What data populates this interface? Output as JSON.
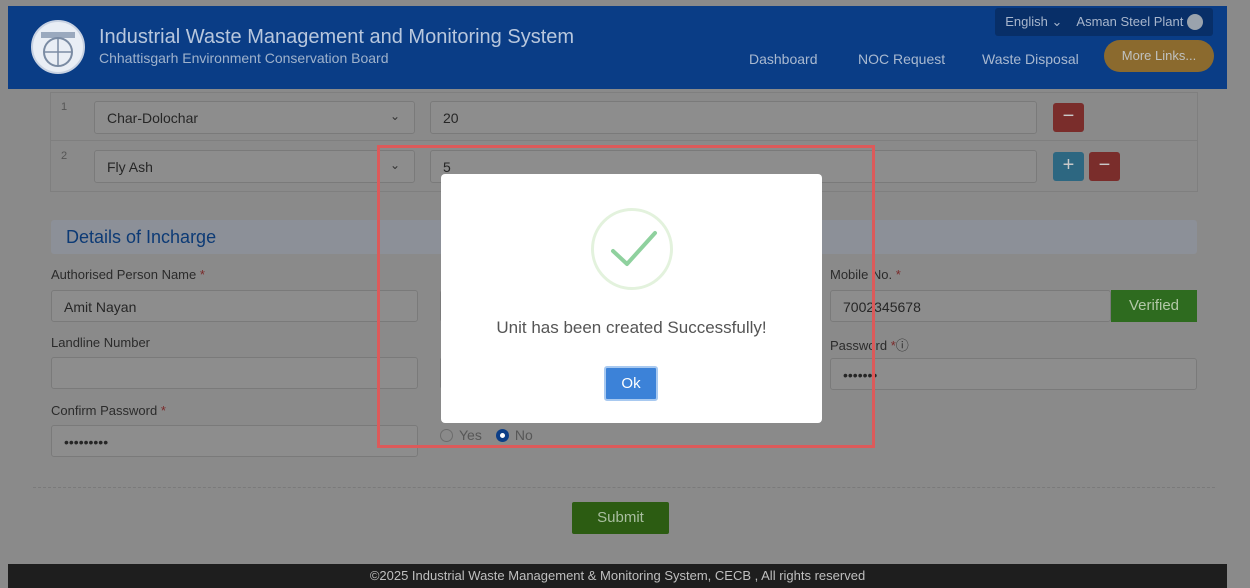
{
  "header": {
    "title": "Industrial Waste Management and Monitoring System",
    "subtitle": "Chhattisgarh Environment Conservation Board",
    "language": "English",
    "company": "Asman Steel Plant",
    "nav": [
      "Dashboard",
      "NOC Request",
      "Waste Disposal",
      "More Links..."
    ]
  },
  "waste_rows": [
    {
      "num": "1",
      "type": "Char-Dolochar",
      "qty": "20"
    },
    {
      "num": "2",
      "type": "Fly Ash",
      "qty": "5"
    }
  ],
  "incharge": {
    "section_title": "Details of Incharge",
    "auth_label": "Authorised Person Name",
    "auth_value": "Amit Nayan",
    "mobile_label": "Mobile No.",
    "mobile_value": "7002345678",
    "verified_label": "Verified",
    "landline_label": "Landline Number",
    "password_label": "Password",
    "password_value": "•••••••",
    "confirm_label": "Confirm Password",
    "confirm_value": "•••••••••",
    "radio_yes": "Yes",
    "radio_no": "No",
    "required_mark": "*",
    "info_icon": "ⓘ"
  },
  "submit_label": "Submit",
  "footer": "©2025 Industrial Waste Management & Monitoring System, CECB , All rights reserved",
  "modal": {
    "message": "Unit has been created Successfully!",
    "ok_label": "Ok"
  },
  "colors": {
    "header_bg": "#0a3d86",
    "success_green": "#8fd19e",
    "ok_blue": "#3c82d8",
    "highlight_red": "#dc5a5a"
  }
}
